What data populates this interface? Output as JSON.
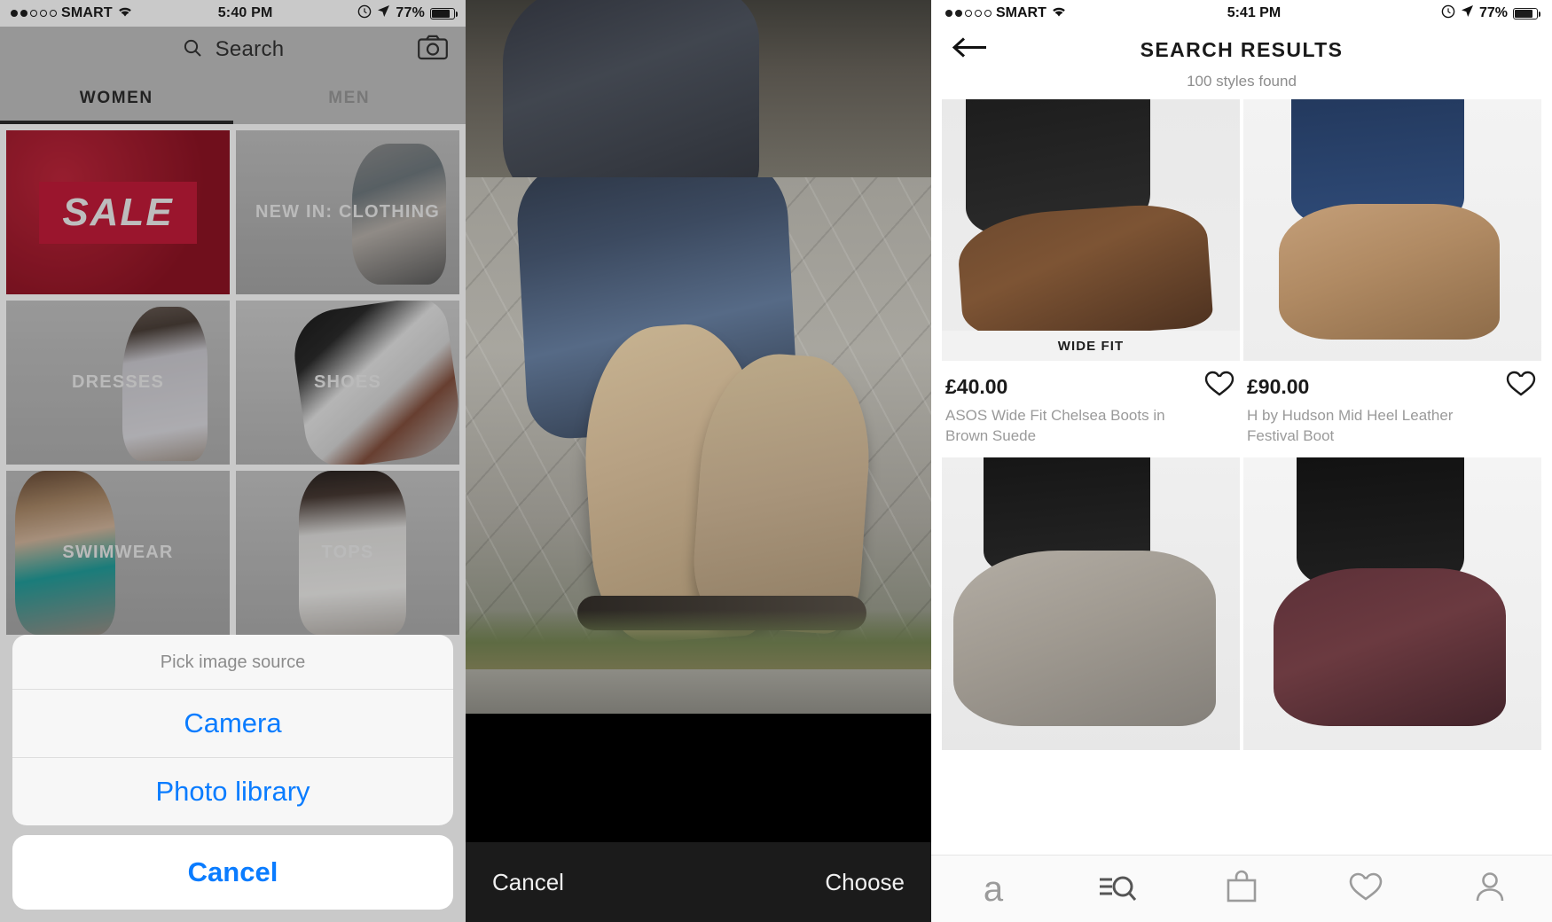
{
  "left_panel": {
    "status_bar": {
      "carrier": "SMART",
      "time": "5:40 PM",
      "battery": "77%",
      "wifi_icon": "wifi-icon",
      "location_icon": "location-arrow-icon",
      "alarm_icon": "alarm-icon"
    },
    "search": {
      "placeholder": "Search",
      "search_icon": "search-icon",
      "camera_icon": "camera-icon"
    },
    "tabs": [
      {
        "label": "WOMEN",
        "active": true
      },
      {
        "label": "MEN",
        "active": false
      }
    ],
    "categories": [
      {
        "label": "SALE",
        "style": "sale"
      },
      {
        "label": "NEW IN: CLOTHING",
        "style": "cloth"
      },
      {
        "label": "DRESSES",
        "style": "dress"
      },
      {
        "label": "SHOES",
        "style": "shoes"
      },
      {
        "label": "SWIMWEAR",
        "style": "swim"
      },
      {
        "label": "TOPS",
        "style": "tops"
      }
    ],
    "action_sheet": {
      "title": "Pick image source",
      "options": [
        "Camera",
        "Photo library"
      ],
      "cancel": "Cancel"
    }
  },
  "mid_panel": {
    "cancel_label": "Cancel",
    "choose_label": "Choose"
  },
  "right_panel": {
    "status_bar": {
      "carrier": "SMART",
      "time": "5:41 PM",
      "battery": "77%"
    },
    "nav": {
      "title": "SEARCH RESULTS",
      "back_icon": "back-arrow-icon"
    },
    "subtitle": "100 styles found",
    "products": [
      {
        "price": "£40.00",
        "name": "ASOS Wide Fit Chelsea Boots in Brown Suede",
        "badge": "WIDE FIT",
        "shot": "s1"
      },
      {
        "price": "£90.00",
        "name": "H by Hudson Mid Heel Leather Festival Boot",
        "badge": "",
        "shot": "s2"
      },
      {
        "price": "",
        "name": "",
        "badge": "",
        "shot": "s3"
      },
      {
        "price": "",
        "name": "",
        "badge": "",
        "shot": "s4"
      }
    ],
    "tabbar": [
      {
        "icon": "asos-logo-icon",
        "label": "a"
      },
      {
        "icon": "search-filter-icon",
        "label": ""
      },
      {
        "icon": "shopping-bag-icon",
        "label": ""
      },
      {
        "icon": "heart-icon",
        "label": ""
      },
      {
        "icon": "person-icon",
        "label": ""
      }
    ],
    "accent_color": "#0a7cff"
  }
}
